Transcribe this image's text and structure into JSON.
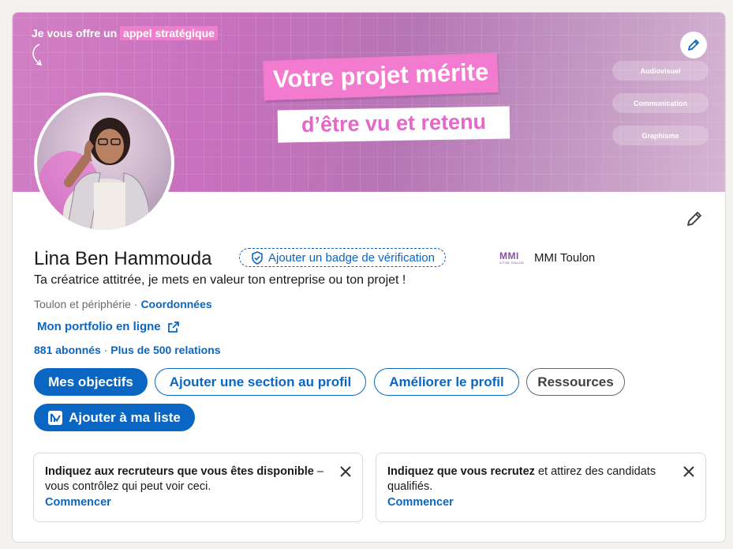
{
  "banner": {
    "tagline_prefix": "Je vous offre un",
    "tagline_highlight": "appel stratégique",
    "headline_line1": "Votre projet mérite",
    "headline_line2": "d’être vu et retenu",
    "tags": [
      "Audiovisuel",
      "Communication",
      "Graphisme"
    ],
    "edit_icon": "pencil-icon"
  },
  "profile": {
    "name": "Lina Ben Hammouda",
    "verify_badge": "Ajouter un badge de vérification",
    "company_logo_text": "MMI",
    "company_logo_sub": "IUT DE TOULON",
    "company": "MMI Toulon",
    "headline": "Ta créatrice attitrée, je mets en valeur ton entreprise ou ton projet !",
    "location": "Toulon et périphérie",
    "location_separator": " · ",
    "contact_link": "Coordonnées",
    "portfolio_link": "Mon portfolio en ligne",
    "followers": "881 abonnés",
    "stats_separator": " · ",
    "connections": "Plus de 500 relations",
    "edit_icon": "pencil-icon"
  },
  "actions": {
    "goals": "Mes objectifs",
    "add_section": "Ajouter une section au profil",
    "improve": "Améliorer le profil",
    "resources": "Ressources",
    "add_to_list": "Ajouter à ma liste"
  },
  "cards": [
    {
      "bold": "Indiquez aux recruteurs que vous êtes disponible",
      "rest": " – vous contrôlez qui peut voir ceci.",
      "cta": "Commencer"
    },
    {
      "bold": "Indiquez que vous recrutez",
      "rest": " et attirez des candidats qualifiés.",
      "cta": "Commencer"
    }
  ],
  "colors": {
    "link": "#0a66c2",
    "banner_pink": "#f27bcf",
    "background": "#f4f2ee"
  }
}
